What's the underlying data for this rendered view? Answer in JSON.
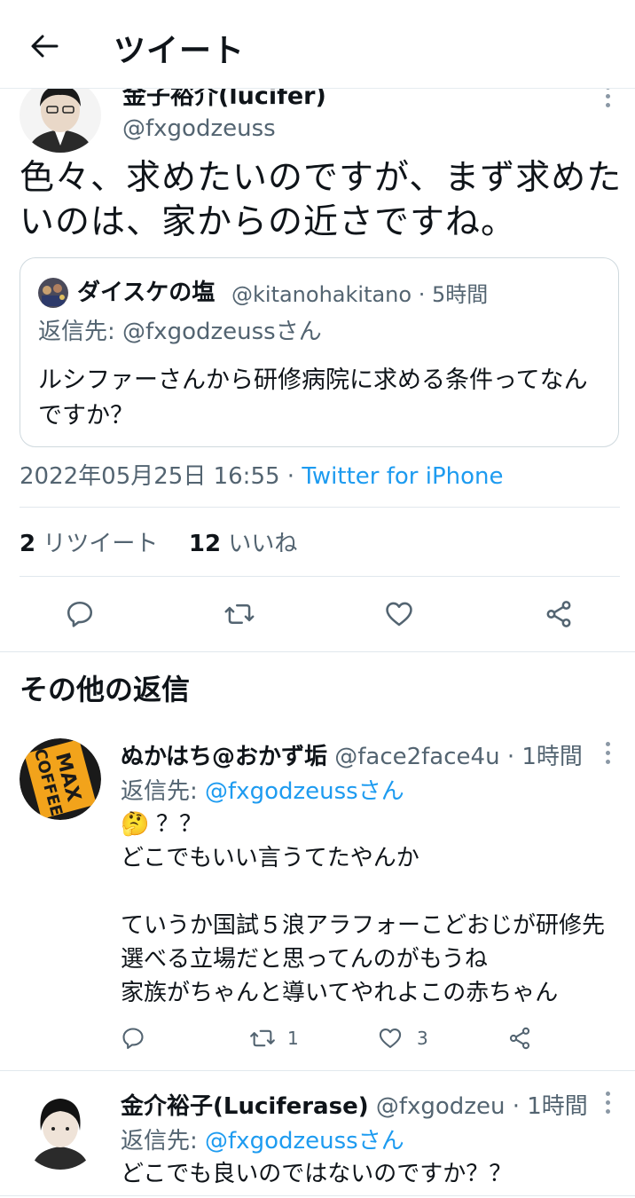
{
  "header": {
    "title": "ツイート"
  },
  "tweet": {
    "author_name": "金子裕介(lucifer)",
    "author_handle": "@fxgodzeuss",
    "text": "色々、求めたいのですが、まず求めたいのは、家からの近さですね。",
    "quote": {
      "name": "ダイスケの塩",
      "handle_time": "@kitanohakitano · 5時間",
      "reply_prefix": "返信先: ",
      "reply_to": "@fxgodzeussさん",
      "text": "ルシファーさんから研修病院に求める条件ってなんですか？"
    },
    "timestamp": "2022年05月25日 16:55 · ",
    "client": "Twitter for iPhone",
    "retweet_count": "2",
    "retweet_label": " リツイート",
    "like_count": "12",
    "like_label": " いいね"
  },
  "section_title": "その他の返信",
  "replies": [
    {
      "name": "ぬかはち@おかず垢",
      "handle_time": " @face2face4u · 1時間",
      "reply_prefix": "返信先: ",
      "reply_to": "@fxgodzeussさん",
      "emoji": "🤔",
      "text": "？？\nどこでもいい言うてたやんか\n\nていうか国試５浪アラフォーこどおじが研修先選べる立場だと思ってんのがもうね\n家族がちゃんと導いてやれよこの赤ちゃん",
      "retweets": "1",
      "likes": "3",
      "avatar_text": "MAX COFFEE"
    },
    {
      "name": "金介裕子(Luciferase)",
      "handle_time": " @fxgodzeu · 1時間",
      "reply_prefix": "返信先: ",
      "reply_to": "@fxgodzeussさん",
      "text": "どこでも良いのではないのですか？？"
    }
  ],
  "colors": {
    "accent": "#1d9bf0",
    "secondary_text": "#536471",
    "border": "#cfd9de"
  }
}
